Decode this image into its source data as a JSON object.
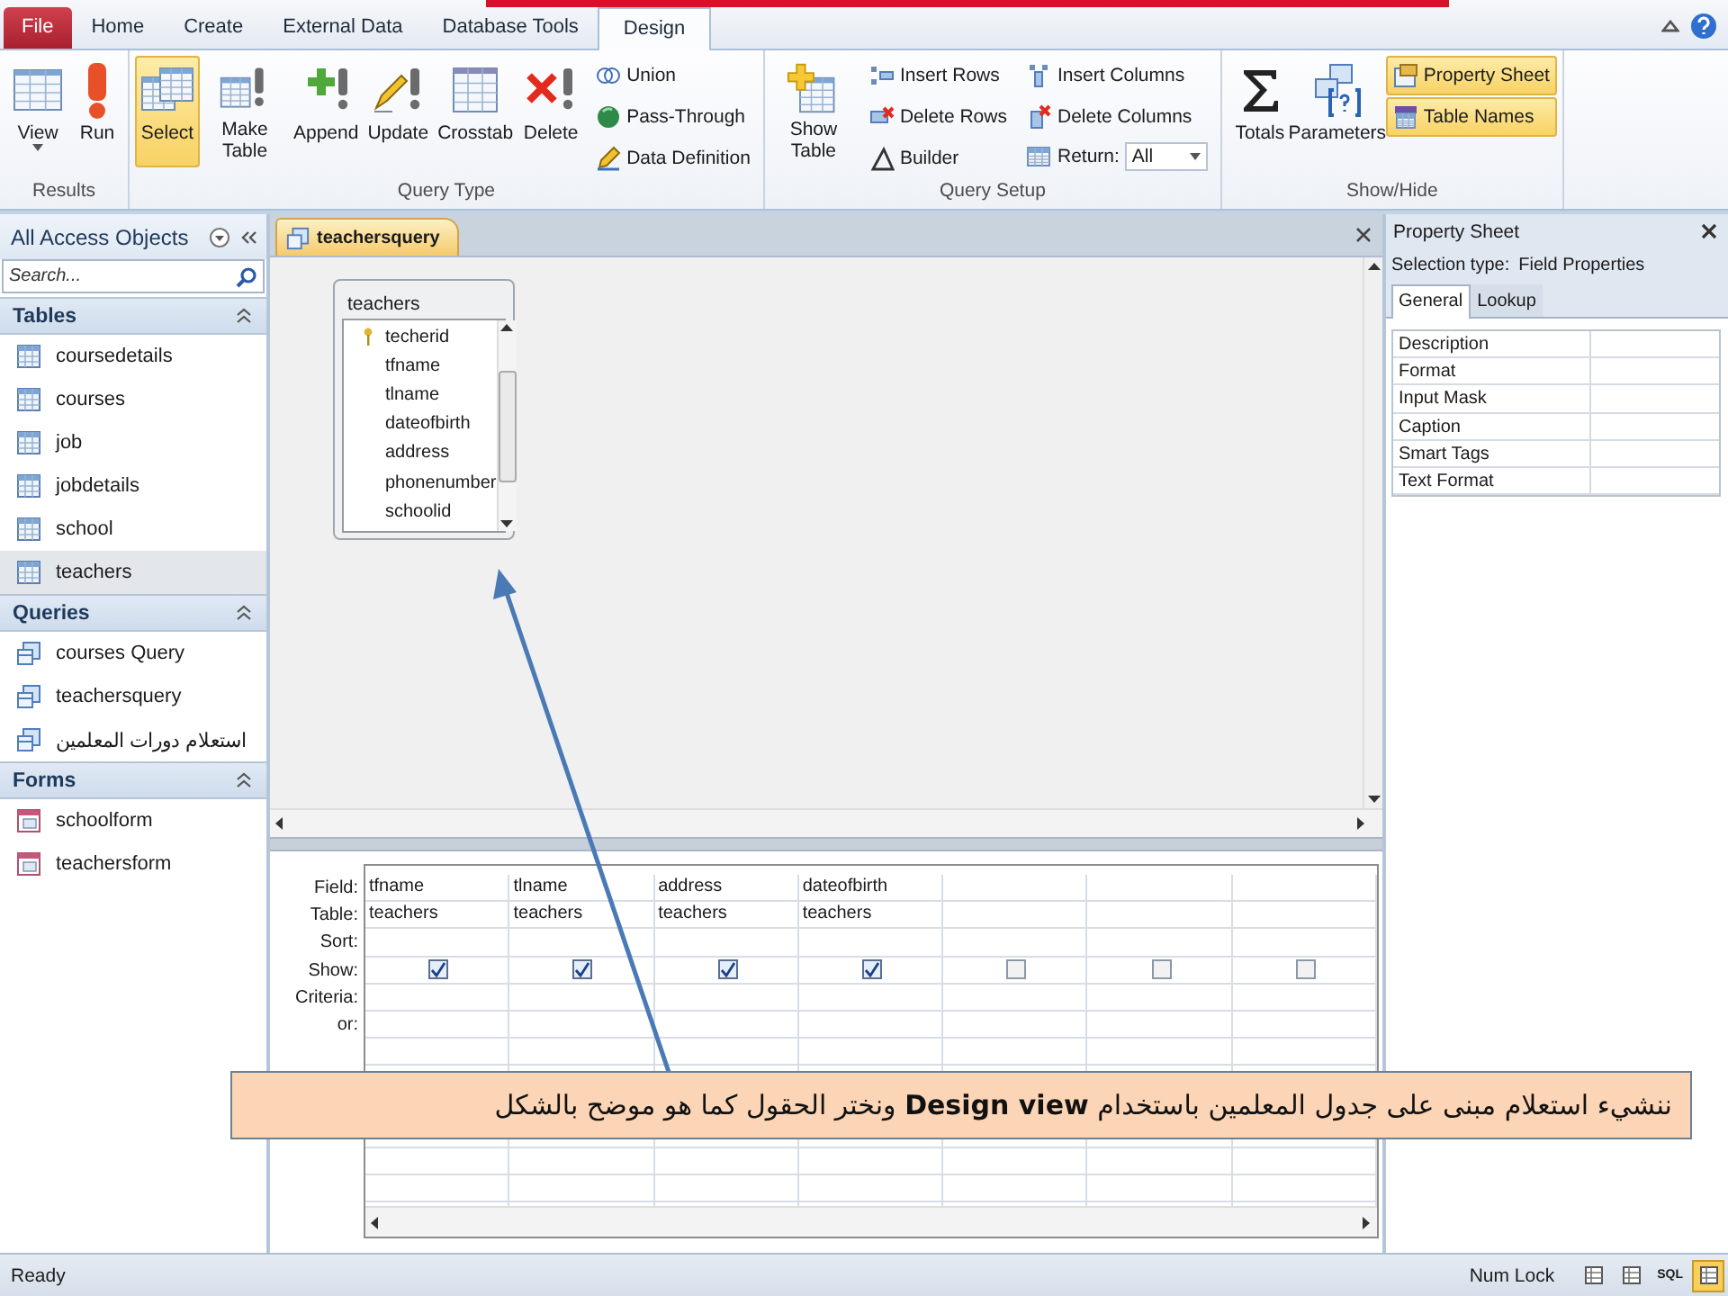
{
  "ribbon_tabs": [
    {
      "label": "File",
      "kind": "file",
      "selected": false
    },
    {
      "label": "Home",
      "kind": "tab",
      "selected": false
    },
    {
      "label": "Create",
      "kind": "tab",
      "selected": false
    },
    {
      "label": "External Data",
      "kind": "tab",
      "selected": false
    },
    {
      "label": "Database Tools",
      "kind": "tab",
      "selected": false
    },
    {
      "label": "Design",
      "kind": "tab",
      "selected": true
    }
  ],
  "ribbon": {
    "groups": [
      {
        "label": "Results",
        "items": [
          {
            "kind": "large",
            "label": "View",
            "dropdown": true,
            "selected": false
          },
          {
            "kind": "large",
            "label": "Run",
            "selected": false
          }
        ]
      },
      {
        "label": "Query Type",
        "items": [
          {
            "kind": "large",
            "label": "Select",
            "selected": true
          },
          {
            "kind": "large",
            "label": "Make Table",
            "selected": false
          },
          {
            "kind": "large",
            "label": "Append",
            "selected": false
          },
          {
            "kind": "large",
            "label": "Update",
            "selected": false
          },
          {
            "kind": "large",
            "label": "Crosstab",
            "selected": false
          },
          {
            "kind": "large",
            "label": "Delete",
            "selected": false
          },
          {
            "kind": "stack",
            "items": [
              {
                "kind": "button",
                "label": "Union",
                "selected": false
              },
              {
                "kind": "button",
                "label": "Pass-Through",
                "selected": false
              },
              {
                "kind": "button",
                "label": "Data Definition",
                "selected": false
              }
            ]
          }
        ]
      },
      {
        "label": "Query Setup",
        "items": [
          {
            "kind": "large",
            "label": "Show Table",
            "selected": false
          },
          {
            "kind": "stack",
            "items": [
              {
                "kind": "button",
                "label": "Insert Rows",
                "selected": false
              },
              {
                "kind": "button",
                "label": "Delete Rows",
                "selected": false
              },
              {
                "kind": "button",
                "label": "Builder",
                "selected": false
              }
            ]
          },
          {
            "kind": "stack",
            "items": [
              {
                "kind": "button",
                "label": "Insert Columns",
                "selected": false
              },
              {
                "kind": "button",
                "label": "Delete Columns",
                "selected": false
              },
              {
                "kind": "combo",
                "label": "Return:",
                "value": "All"
              }
            ]
          }
        ]
      },
      {
        "label": "Show/Hide",
        "items": [
          {
            "kind": "large",
            "label": "Totals",
            "selected": false
          },
          {
            "kind": "large",
            "label": "Parameters",
            "selected": false
          },
          {
            "kind": "stack",
            "items": [
              {
                "kind": "button",
                "label": "Property Sheet",
                "selected": true
              },
              {
                "kind": "button",
                "label": "Table Names",
                "selected": true
              }
            ]
          }
        ]
      }
    ]
  },
  "navigation_pane": {
    "title": "All Access Objects",
    "search": {
      "placeholder": "Search..."
    },
    "sections": [
      {
        "label": "Tables",
        "kind": "table",
        "expanded": true,
        "items": [
          {
            "label": "coursedetails",
            "selected": false
          },
          {
            "label": "courses",
            "selected": false
          },
          {
            "label": "job",
            "selected": false
          },
          {
            "label": "jobdetails",
            "selected": false
          },
          {
            "label": "school",
            "selected": false
          },
          {
            "label": "teachers",
            "selected": true
          }
        ]
      },
      {
        "label": "Queries",
        "kind": "query",
        "expanded": true,
        "items": [
          {
            "label": "courses Query",
            "selected": false
          },
          {
            "label": "teachersquery",
            "selected": false
          },
          {
            "label": "استعلام دورات المعلمين",
            "selected": false
          }
        ]
      },
      {
        "label": "Forms",
        "kind": "form",
        "expanded": true,
        "items": [
          {
            "label": "schoolform",
            "selected": false
          },
          {
            "label": "teachersform",
            "selected": false
          }
        ]
      }
    ]
  },
  "document": {
    "tab": {
      "label": "teachersquery"
    },
    "tables": [
      {
        "title": "teachers",
        "fields": [
          {
            "name": "techerid",
            "primary_key": true
          },
          {
            "name": "tfname",
            "primary_key": false
          },
          {
            "name": "tlname",
            "primary_key": false
          },
          {
            "name": "dateofbirth",
            "primary_key": false
          },
          {
            "name": "address",
            "primary_key": false
          },
          {
            "name": "phonenumber",
            "primary_key": false
          },
          {
            "name": "schoolid",
            "primary_key": false
          }
        ]
      }
    ],
    "grid": {
      "row_labels": [
        "Field:",
        "Table:",
        "Sort:",
        "Show:",
        "Criteria:",
        "or:"
      ],
      "columns": [
        {
          "field": "tfname",
          "table": "teachers",
          "show": true
        },
        {
          "field": "tlname",
          "table": "teachers",
          "show": true
        },
        {
          "field": "address",
          "table": "teachers",
          "show": true
        },
        {
          "field": "dateofbirth",
          "table": "teachers",
          "show": true
        },
        {
          "show": false
        },
        {
          "show": false
        },
        {
          "show": false
        }
      ]
    }
  },
  "property_sheet": {
    "title": "Property Sheet",
    "selection_type_label": "Selection type:",
    "selection_type": "Field Properties",
    "tabs": [
      {
        "label": "General",
        "selected": true
      },
      {
        "label": "Lookup",
        "selected": false
      }
    ],
    "properties": [
      "Description",
      "Format",
      "Input Mask",
      "Caption",
      "Smart Tags",
      "Text Format"
    ]
  },
  "status_bar": {
    "text": "Ready",
    "indicator": "Num Lock",
    "view_buttons": [
      {
        "selected": false
      },
      {
        "selected": false
      },
      {
        "label": "SQL",
        "selected": false
      },
      {
        "selected": true
      }
    ]
  },
  "callout": {
    "text": "ننشيء استعلام مبنى على جدول المعلمين باستخدام **Design view** ونختر الحقول كما هو موضح بالشكل"
  }
}
